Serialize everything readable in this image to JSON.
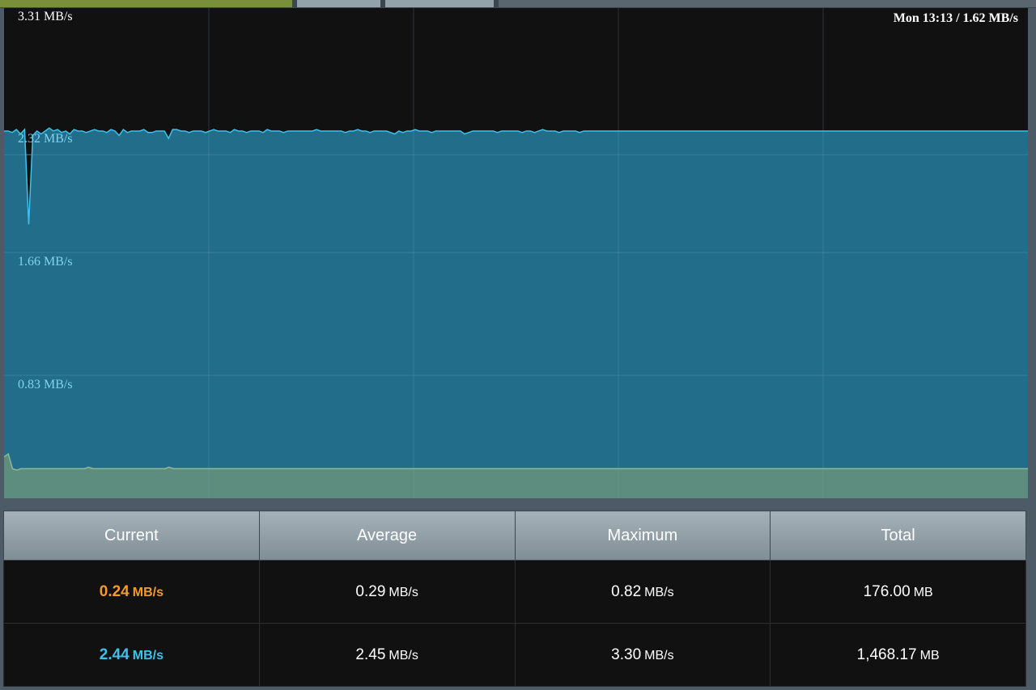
{
  "colors": {
    "background": "#111111",
    "upload_fill": "#226d89",
    "upload_line": "#3dc2ee",
    "download_fill": "#5d8d7e",
    "download_line": "#8fb897",
    "grid": "#2c6a80",
    "current_upload_text": "#f79a2a",
    "current_download_text": "#3dc2ee"
  },
  "status": {
    "readout": "Mon 13:13 / 1.62 MB/s"
  },
  "chart_data": {
    "type": "area",
    "title": "",
    "ylabel": "",
    "xlabel": "",
    "ylim": [
      0,
      3.31
    ],
    "yticks": [
      "3.31 MB/s",
      "2.32 MB/s",
      "1.66 MB/s",
      "0.83 MB/s"
    ],
    "ytick_values": [
      3.31,
      2.32,
      1.66,
      0.83
    ],
    "grid": true,
    "series": [
      {
        "color": "#3dc2ee",
        "values": [
          2.48,
          2.48,
          2.47,
          2.49,
          2.46,
          2.49,
          1.85,
          2.45,
          2.48,
          2.46,
          2.48,
          2.5,
          2.48,
          2.49,
          2.47,
          2.48,
          2.46,
          2.49,
          2.48,
          2.48,
          2.47,
          2.48,
          2.49,
          2.48,
          2.48,
          2.47,
          2.49,
          2.48,
          2.45,
          2.49,
          2.47,
          2.48,
          2.48,
          2.48,
          2.49,
          2.47,
          2.47,
          2.48,
          2.48,
          2.48,
          2.43,
          2.49,
          2.49,
          2.48,
          2.48,
          2.47,
          2.48,
          2.48,
          2.48,
          2.47,
          2.48,
          2.49,
          2.48,
          2.48,
          2.48,
          2.47,
          2.49,
          2.48,
          2.48,
          2.47,
          2.48,
          2.48,
          2.48,
          2.47,
          2.49,
          2.48,
          2.48,
          2.48,
          2.47,
          2.48,
          2.48,
          2.48,
          2.48,
          2.48,
          2.48,
          2.48,
          2.49,
          2.48,
          2.48,
          2.48,
          2.48,
          2.48,
          2.48,
          2.47,
          2.48,
          2.48,
          2.49,
          2.48,
          2.48,
          2.47,
          2.48,
          2.48,
          2.48,
          2.48,
          2.47,
          2.46,
          2.48,
          2.47,
          2.48,
          2.48,
          2.49,
          2.48,
          2.48,
          2.48,
          2.47,
          2.48,
          2.48,
          2.48,
          2.48,
          2.48,
          2.48,
          2.48,
          2.46,
          2.47,
          2.48,
          2.48,
          2.48,
          2.48,
          2.48,
          2.48,
          2.47,
          2.48,
          2.48,
          2.48,
          2.48,
          2.48,
          2.47,
          2.48,
          2.48,
          2.47,
          2.48,
          2.49,
          2.48,
          2.48,
          2.48,
          2.47,
          2.48,
          2.48,
          2.48,
          2.48,
          2.47,
          2.48,
          2.48,
          2.48,
          2.48,
          2.48,
          2.48,
          2.48,
          2.48,
          2.48,
          2.48,
          2.48,
          2.48,
          2.48,
          2.48,
          2.48,
          2.48,
          2.48,
          2.48,
          2.48,
          2.48,
          2.48,
          2.48,
          2.48,
          2.48,
          2.48,
          2.48,
          2.48,
          2.48,
          2.48,
          2.48,
          2.48,
          2.48,
          2.48,
          2.48,
          2.48,
          2.48,
          2.48,
          2.48,
          2.48,
          2.48,
          2.48,
          2.48,
          2.48,
          2.48,
          2.48,
          2.48,
          2.48,
          2.48,
          2.48,
          2.48,
          2.48,
          2.48,
          2.48,
          2.48,
          2.48,
          2.48,
          2.48,
          2.48,
          2.48,
          2.48,
          2.48,
          2.48,
          2.48,
          2.48,
          2.48,
          2.48,
          2.48,
          2.48,
          2.48,
          2.48,
          2.48,
          2.48,
          2.48,
          2.48,
          2.48,
          2.48,
          2.48,
          2.48,
          2.48,
          2.48,
          2.48,
          2.48,
          2.48,
          2.48,
          2.48,
          2.48,
          2.48,
          2.48,
          2.48,
          2.48,
          2.48,
          2.48,
          2.48,
          2.48,
          2.48,
          2.48,
          2.48,
          2.48,
          2.48,
          2.48,
          2.48,
          2.48,
          2.48,
          2.48,
          2.48,
          2.48,
          2.48,
          2.48,
          2.48
        ]
      },
      {
        "color": "#8fb897",
        "values": [
          0.28,
          0.3,
          0.2,
          0.19,
          0.2,
          0.2,
          0.2,
          0.2,
          0.2,
          0.2,
          0.2,
          0.2,
          0.2,
          0.2,
          0.2,
          0.2,
          0.2,
          0.2,
          0.2,
          0.2,
          0.21,
          0.2,
          0.2,
          0.2,
          0.2,
          0.2,
          0.2,
          0.2,
          0.2,
          0.2,
          0.2,
          0.2,
          0.2,
          0.2,
          0.2,
          0.2,
          0.2,
          0.2,
          0.2,
          0.21,
          0.2,
          0.2,
          0.2,
          0.2,
          0.2,
          0.2,
          0.2,
          0.2,
          0.2,
          0.2,
          0.2,
          0.2,
          0.2,
          0.2,
          0.2,
          0.2,
          0.2,
          0.2,
          0.2,
          0.2,
          0.2,
          0.2,
          0.2,
          0.2,
          0.2,
          0.2,
          0.2,
          0.2,
          0.2,
          0.2,
          0.2,
          0.2,
          0.2,
          0.2,
          0.2,
          0.2,
          0.2,
          0.2,
          0.2,
          0.2,
          0.2,
          0.2,
          0.2,
          0.2,
          0.2,
          0.2,
          0.2,
          0.2,
          0.2,
          0.2,
          0.2,
          0.2,
          0.2,
          0.2,
          0.2,
          0.2,
          0.2,
          0.2,
          0.2,
          0.2,
          0.2,
          0.2,
          0.2,
          0.2,
          0.2,
          0.2,
          0.2,
          0.2,
          0.2,
          0.2,
          0.2,
          0.2,
          0.2,
          0.2,
          0.2,
          0.2,
          0.2,
          0.2,
          0.2,
          0.2,
          0.2,
          0.2,
          0.2,
          0.2,
          0.2,
          0.2,
          0.2,
          0.2,
          0.2,
          0.2,
          0.2,
          0.2,
          0.2,
          0.2,
          0.2,
          0.2,
          0.2,
          0.2,
          0.2,
          0.2,
          0.2,
          0.2,
          0.2,
          0.2,
          0.2,
          0.2,
          0.2,
          0.2,
          0.2,
          0.2,
          0.2,
          0.2,
          0.2,
          0.2,
          0.2,
          0.2,
          0.2,
          0.2,
          0.2,
          0.2,
          0.2,
          0.2,
          0.2,
          0.2,
          0.2,
          0.2,
          0.2,
          0.2,
          0.2,
          0.2,
          0.2,
          0.2,
          0.2,
          0.2,
          0.2,
          0.2,
          0.2,
          0.2,
          0.2,
          0.2,
          0.2,
          0.2,
          0.2,
          0.2,
          0.2,
          0.2,
          0.2,
          0.2,
          0.2,
          0.2,
          0.2,
          0.2,
          0.2,
          0.2,
          0.2,
          0.2,
          0.2,
          0.2,
          0.2,
          0.2,
          0.2,
          0.2,
          0.2,
          0.2,
          0.2,
          0.2,
          0.2,
          0.2,
          0.2,
          0.2,
          0.2,
          0.2,
          0.2,
          0.2,
          0.2,
          0.2,
          0.2,
          0.2,
          0.2,
          0.2,
          0.2,
          0.2,
          0.2,
          0.2,
          0.2,
          0.2,
          0.2,
          0.2,
          0.2,
          0.2,
          0.2,
          0.2,
          0.2,
          0.2,
          0.2,
          0.2,
          0.2,
          0.2,
          0.2,
          0.2,
          0.2,
          0.2,
          0.2
        ]
      }
    ]
  },
  "table": {
    "headers": [
      "Current",
      "Average",
      "Maximum",
      "Total"
    ],
    "rows": [
      [
        {
          "value": "0.24",
          "unit": "MB/s"
        },
        {
          "value": "0.29",
          "unit": "MB/s"
        },
        {
          "value": "0.82",
          "unit": "MB/s"
        },
        {
          "value": "176.00",
          "unit": "MB"
        }
      ],
      [
        {
          "value": "2.44",
          "unit": "MB/s"
        },
        {
          "value": "2.45",
          "unit": "MB/s"
        },
        {
          "value": "3.30",
          "unit": "MB/s"
        },
        {
          "value": "1,468.17",
          "unit": "MB"
        }
      ]
    ]
  }
}
